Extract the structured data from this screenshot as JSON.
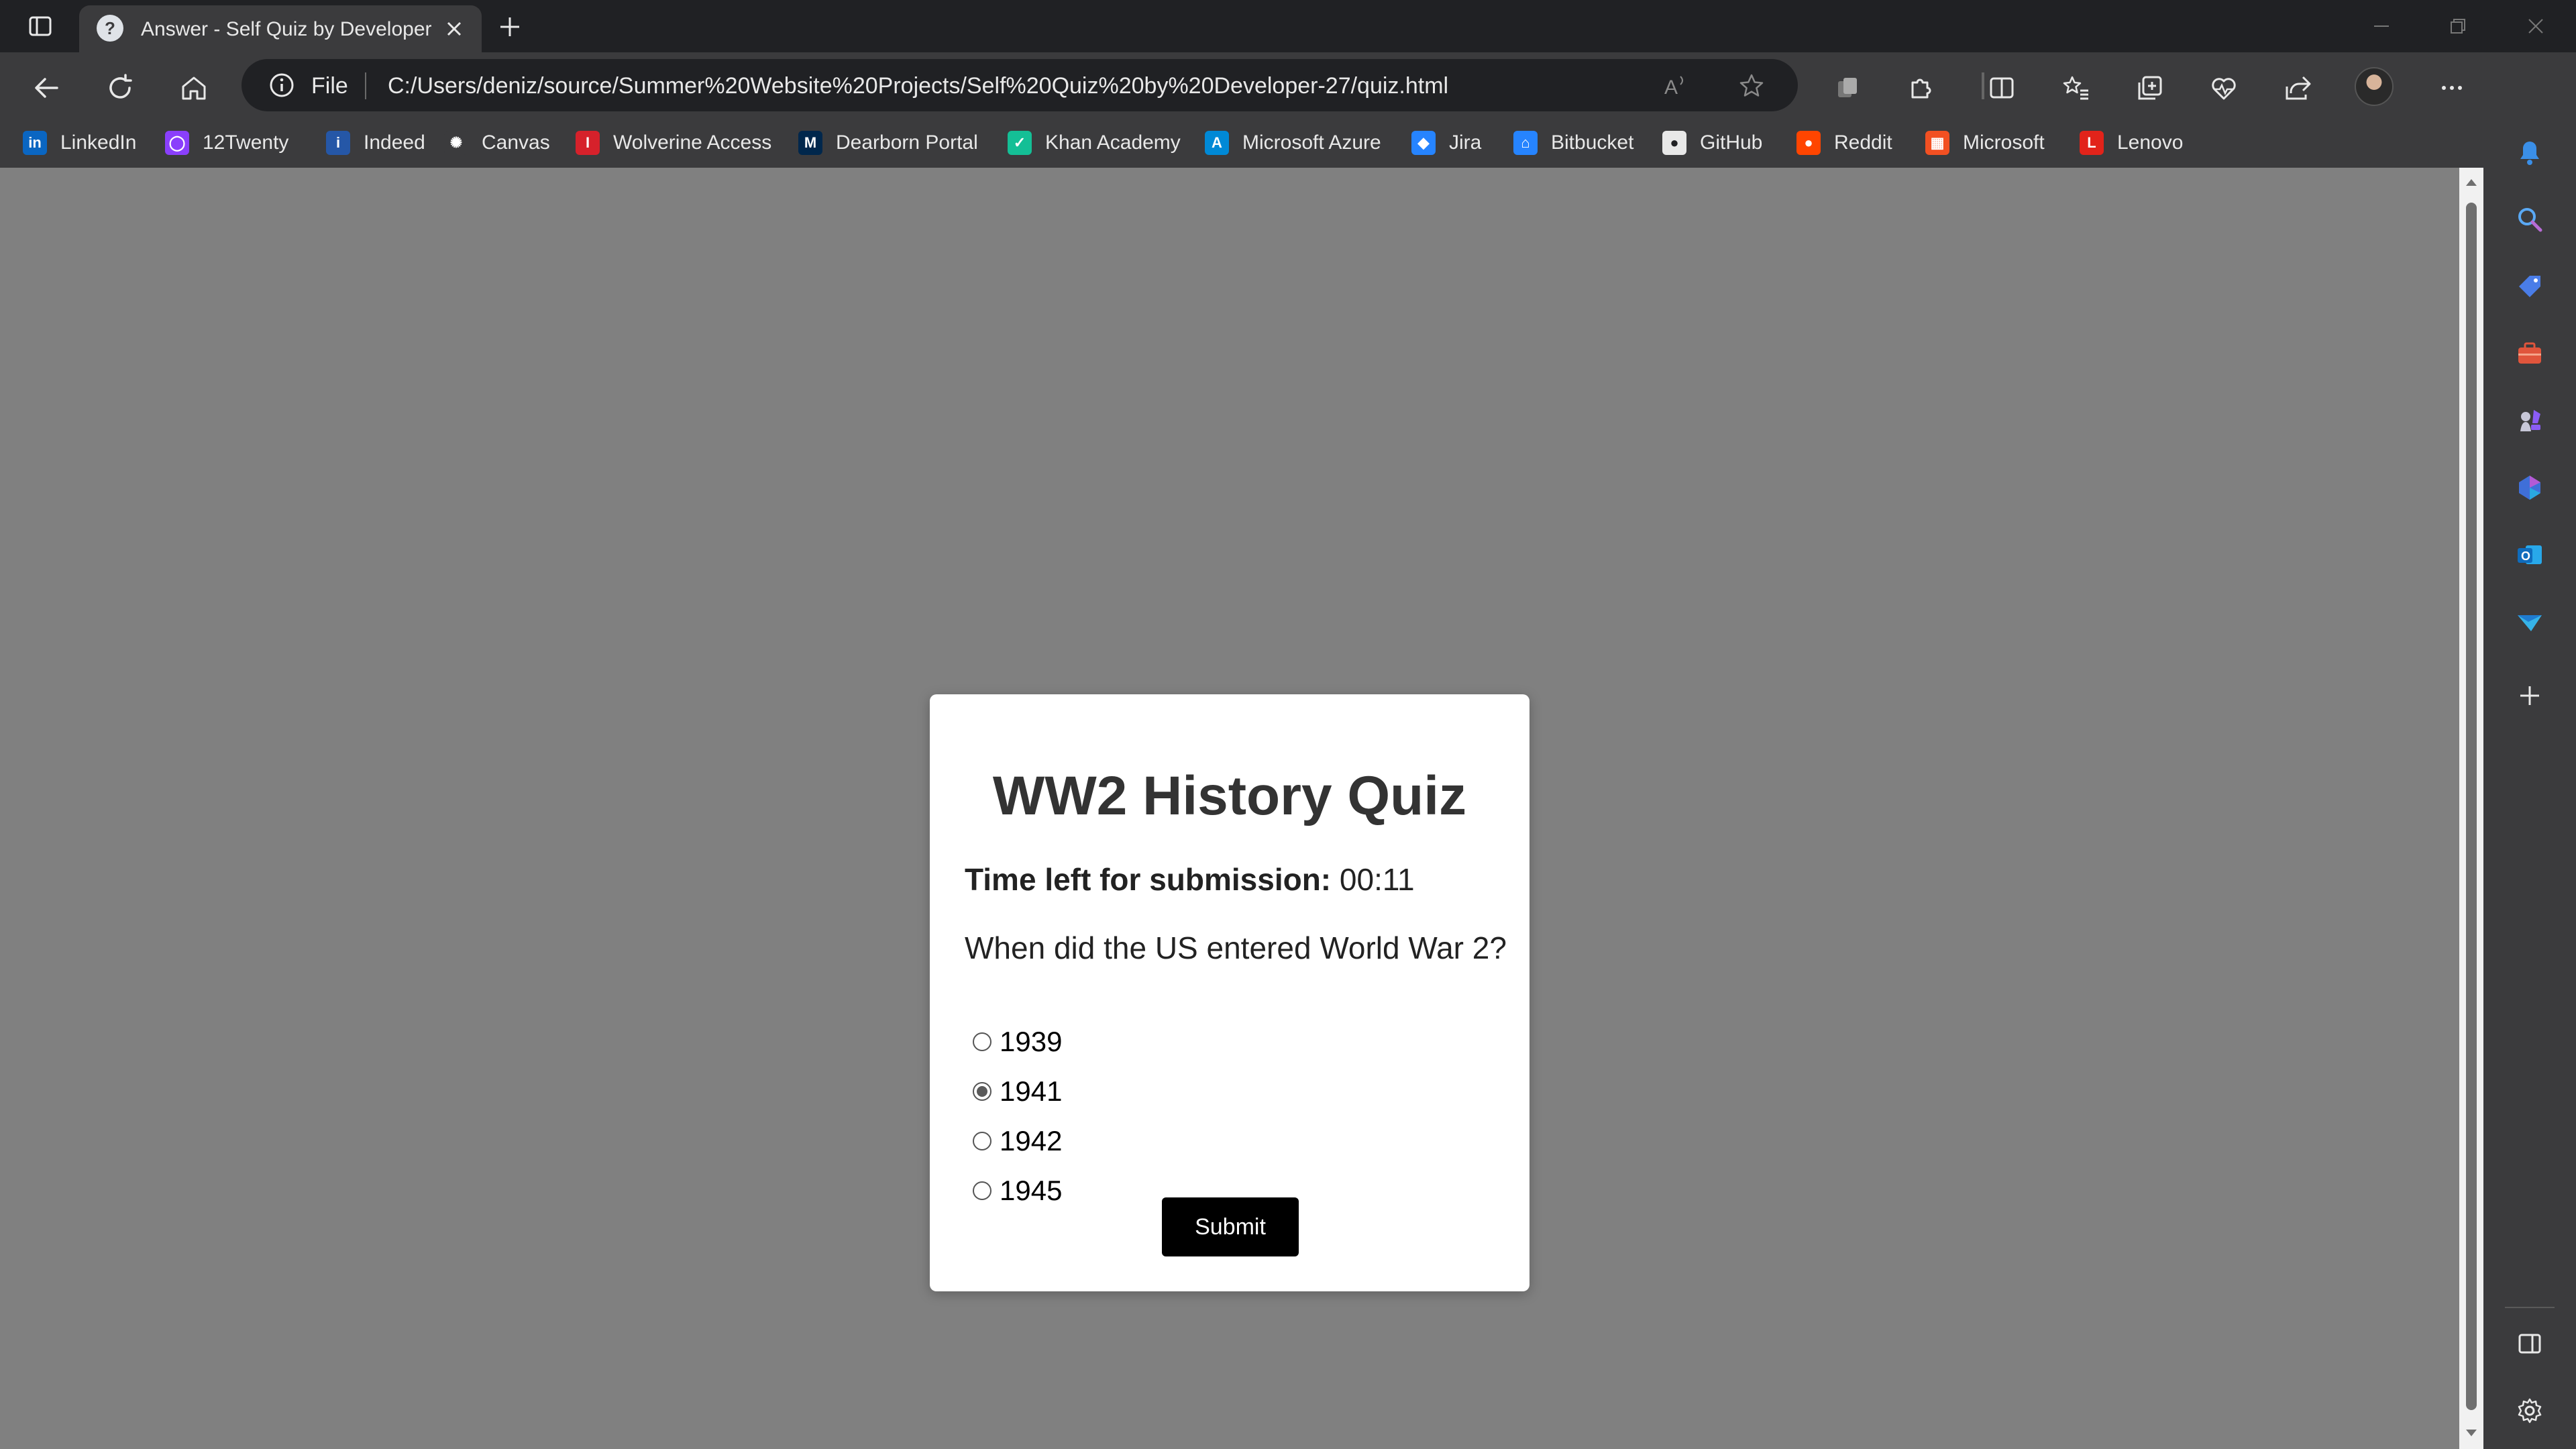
{
  "browser": {
    "tab": {
      "title": "Answer - Self Quiz by Developer",
      "favicon": "question-mark-favicon"
    },
    "address": {
      "scheme_label": "File",
      "url": "C:/Users/deniz/source/Summer%20Website%20Projects/Self%20Quiz%20by%20Developer-27/quiz.html"
    },
    "favorites": [
      {
        "label": "LinkedIn",
        "icon": "linkedin-icon",
        "color": "#0a66c2",
        "glyph": "in"
      },
      {
        "label": "12Twenty",
        "icon": "12twenty-icon",
        "color": "#8a3ffc",
        "glyph": "◯"
      },
      {
        "label": "Indeed",
        "icon": "indeed-icon",
        "color": "#2557a7",
        "glyph": "i"
      },
      {
        "label": "Canvas",
        "icon": "canvas-icon",
        "color": "#3b3b3d",
        "glyph": "✺"
      },
      {
        "label": "Wolverine Access",
        "icon": "wolverine-access-icon",
        "color": "#d6212b",
        "glyph": "I"
      },
      {
        "label": "Dearborn Portal",
        "icon": "dearborn-portal-icon",
        "color": "#00274c",
        "glyph": "M"
      },
      {
        "label": "Khan Academy",
        "icon": "khan-academy-icon",
        "color": "#14bf96",
        "glyph": "✓"
      },
      {
        "label": "Microsoft Azure",
        "icon": "azure-icon",
        "color": "#0089d6",
        "glyph": "A"
      },
      {
        "label": "Jira",
        "icon": "jira-icon",
        "color": "#2684ff",
        "glyph": "◆"
      },
      {
        "label": "Bitbucket",
        "icon": "bitbucket-icon",
        "color": "#2684ff",
        "glyph": "⌂"
      },
      {
        "label": "GitHub",
        "icon": "github-icon",
        "color": "#e8e8e8",
        "glyph": "●"
      },
      {
        "label": "Reddit",
        "icon": "reddit-icon",
        "color": "#ff4500",
        "glyph": "●"
      },
      {
        "label": "Microsoft",
        "icon": "microsoft-icon",
        "color": "#f25022",
        "glyph": "▦"
      },
      {
        "label": "Lenovo",
        "icon": "lenovo-icon",
        "color": "#e2231a",
        "glyph": "L"
      }
    ]
  },
  "quiz": {
    "title": "WW2 History Quiz",
    "timer_label": "Time left for submission:",
    "timer_value": "00:11",
    "question": "When did the US entered World War 2?",
    "options": [
      {
        "label": "1939",
        "selected": false
      },
      {
        "label": "1941",
        "selected": true
      },
      {
        "label": "1942",
        "selected": false
      },
      {
        "label": "1945",
        "selected": false
      }
    ],
    "submit_label": "Submit"
  },
  "colors": {
    "page_background": "#808080",
    "card_background": "#ffffff",
    "submit_background": "#000000",
    "browser_chrome": "#3b3b3d",
    "tabbar": "#202124"
  }
}
